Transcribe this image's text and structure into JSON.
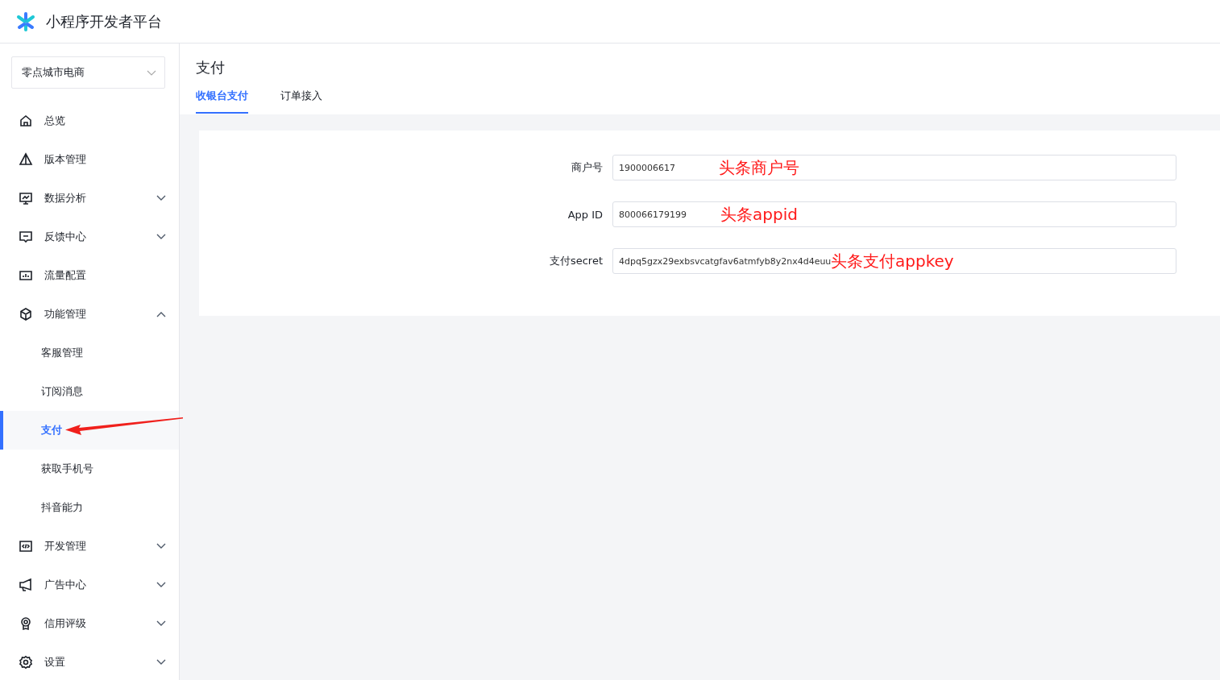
{
  "header": {
    "title": "小程序开发者平台"
  },
  "app_select": {
    "value": "零点城市电商"
  },
  "nav": [
    {
      "label": "总览",
      "kind": "link"
    },
    {
      "label": "版本管理",
      "kind": "link"
    },
    {
      "label": "数据分析",
      "kind": "group",
      "expanded": false
    },
    {
      "label": "反馈中心",
      "kind": "group",
      "expanded": false
    },
    {
      "label": "流量配置",
      "kind": "link"
    },
    {
      "label": "功能管理",
      "kind": "group",
      "expanded": true,
      "children": [
        {
          "label": "客服管理",
          "selected": false
        },
        {
          "label": "订阅消息",
          "selected": false
        },
        {
          "label": "支付",
          "selected": true
        },
        {
          "label": "获取手机号",
          "selected": false
        },
        {
          "label": "抖音能力",
          "selected": false
        }
      ]
    },
    {
      "label": "开发管理",
      "kind": "group",
      "expanded": false
    },
    {
      "label": "广告中心",
      "kind": "group",
      "expanded": false
    },
    {
      "label": "信用评级",
      "kind": "group",
      "expanded": false
    },
    {
      "label": "设置",
      "kind": "group",
      "expanded": false
    }
  ],
  "page": {
    "title": "支付",
    "tabs": [
      {
        "label": "收银台支付",
        "selected": true
      },
      {
        "label": "订单接入",
        "selected": false
      }
    ]
  },
  "form": {
    "fields": [
      {
        "label": "商户号",
        "value": "1900006617",
        "annotation": "头条商户号"
      },
      {
        "label": "App ID",
        "value": "800066179199",
        "annotation": "头条appid"
      },
      {
        "label": "支付secret",
        "value": "4dpq5gzx29exbsvcatgfav6atmfyb8y2nx4d4euu",
        "annotation": "头条支付appkey"
      }
    ]
  }
}
